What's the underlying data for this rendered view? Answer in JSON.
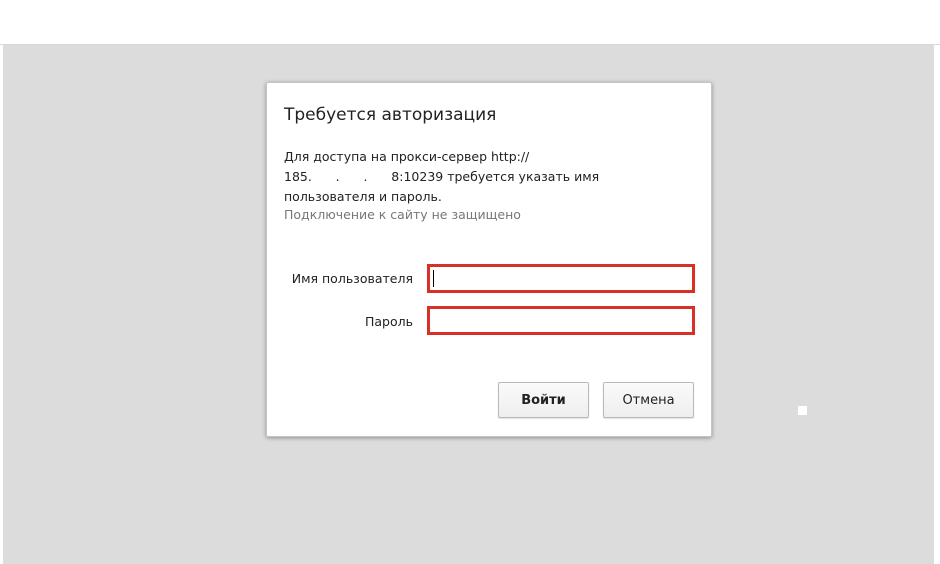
{
  "dialog": {
    "title": "Требуется авторизация",
    "message_lines": [
      "Для доступа на прокси-сервер http://",
      "185.      .      .      8:10239 требуется указать имя",
      "пользователя и пароль."
    ],
    "note": "Подключение к сайту не защищено",
    "username_label": "Имя пользователя",
    "username_value": "",
    "password_label": "Пароль",
    "password_value": "",
    "login_button": "Войти",
    "cancel_button": "Отмена"
  },
  "colors": {
    "field_highlight": "#d93025",
    "page_background": "#dcdcdc"
  }
}
